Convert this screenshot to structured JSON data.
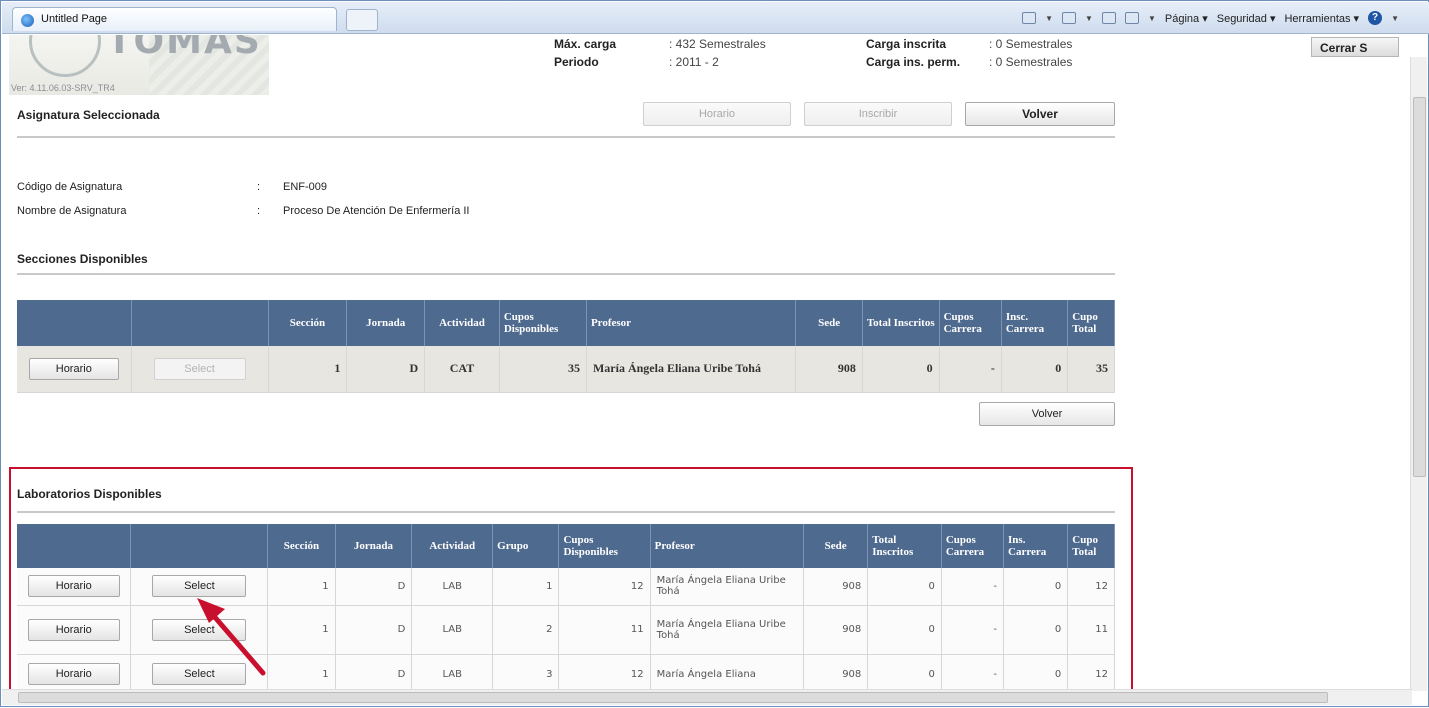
{
  "browser": {
    "tab_title": "Untitled Page",
    "menu": [
      "Página ▾",
      "Seguridad ▾",
      "Herramientas ▾"
    ]
  },
  "header": {
    "logo_text": "TOMAS",
    "version": "Ver: 4.11.06.03-SRV_TR4",
    "max_carga_label": "Máx. carga",
    "max_carga_value": ": 432 Semestrales",
    "periodo_label": "Periodo",
    "periodo_value": ": 2011 - 2",
    "carga_inscrita_label": "Carga inscrita",
    "carga_inscrita_value": ": 0 Semestrales",
    "carga_perm_label": "Carga ins. perm.",
    "carga_perm_value": ": 0 Semestrales",
    "close_label": "Cerrar S"
  },
  "asignatura": {
    "title": "Asignatura Seleccionada",
    "horario_btn": "Horario",
    "inscribir_btn": "Inscribir",
    "volver_btn": "Volver",
    "codigo_label": "Código de Asignatura",
    "codigo_sep": ":",
    "codigo_value": "ENF-009",
    "nombre_label": "Nombre de Asignatura",
    "nombre_sep": ":",
    "nombre_value": "Proceso De Atención De Enfermería II"
  },
  "secciones": {
    "title": "Secciones Disponibles",
    "headers": [
      "",
      "",
      "Sección",
      "Jornada",
      "Actividad",
      "Cupos Disponibles",
      "Profesor",
      "Sede",
      "Total Inscritos",
      "Cupos Carrera",
      "Insc. Carrera",
      "Cupo Total"
    ],
    "rows": [
      {
        "horario": "Horario",
        "select": "Select",
        "seccion": "1",
        "jornada": "D",
        "actividad": "CAT",
        "cupos": "35",
        "profesor": "María Ángela Eliana Uribe Tohá",
        "sede": "908",
        "total": "0",
        "cupos_carrera": "-",
        "insc_carrera": "0",
        "cupo_total": "35"
      }
    ],
    "volver_btn": "Volver"
  },
  "laboratorios": {
    "title": "Laboratorios Disponibles",
    "headers": [
      "",
      "",
      "Sección",
      "Jornada",
      "Actividad",
      "Grupo",
      "Cupos Disponibles",
      "Profesor",
      "Sede",
      "Total Inscritos",
      "Cupos Carrera",
      "Ins. Carrera",
      "Cupo Total"
    ],
    "rows": [
      {
        "horario": "Horario",
        "select": "Select",
        "seccion": "1",
        "jornada": "D",
        "actividad": "LAB",
        "grupo": "1",
        "cupos": "12",
        "profesor": "María Ángela Eliana Uribe Tohá",
        "sede": "908",
        "total": "0",
        "cupos_carrera": "-",
        "insc_carrera": "0",
        "cupo_total": "12"
      },
      {
        "horario": "Horario",
        "select": "Select",
        "seccion": "1",
        "jornada": "D",
        "actividad": "LAB",
        "grupo": "2",
        "cupos": "11",
        "profesor": "María Ángela Eliana Uribe Tohá",
        "sede": "908",
        "total": "0",
        "cupos_carrera": "-",
        "insc_carrera": "0",
        "cupo_total": "11"
      },
      {
        "horario": "Horario",
        "select": "Select",
        "seccion": "1",
        "jornada": "D",
        "actividad": "LAB",
        "grupo": "3",
        "cupos": "12",
        "profesor": "María Ángela Eliana",
        "sede": "908",
        "total": "0",
        "cupos_carrera": "-",
        "insc_carrera": "0",
        "cupo_total": "12"
      }
    ]
  },
  "colors": {
    "table_header": "#4f6a8f",
    "highlight_box": "#c8102e",
    "arrow": "#c8102e",
    "link": "#3d6aa6"
  }
}
